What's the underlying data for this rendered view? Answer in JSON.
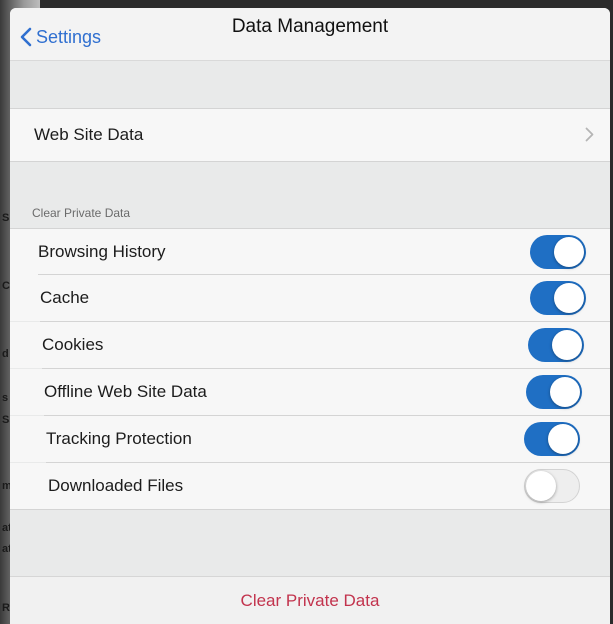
{
  "navbar": {
    "back_label": "Settings",
    "title": "Data Management"
  },
  "website_row": {
    "label": "Web Site Data"
  },
  "clear_section": {
    "header": "Clear Private Data",
    "items": [
      {
        "label": "Browsing History",
        "enabled": true
      },
      {
        "label": "Cache",
        "enabled": true
      },
      {
        "label": "Cookies",
        "enabled": true
      },
      {
        "label": "Offline Web Site Data",
        "enabled": true
      },
      {
        "label": "Tracking Protection",
        "enabled": true
      },
      {
        "label": "Downloaded Files",
        "enabled": false
      }
    ]
  },
  "clear_button": {
    "label": "Clear Private Data"
  },
  "colors": {
    "accent": "#1f6fc4",
    "destructive": "#c2334d",
    "link": "#2f6fd0"
  },
  "background_fragments": [
    "S",
    "Cl",
    "d",
    "s",
    "Ss",
    "m C",
    "atin",
    "atin",
    "Refu"
  ]
}
